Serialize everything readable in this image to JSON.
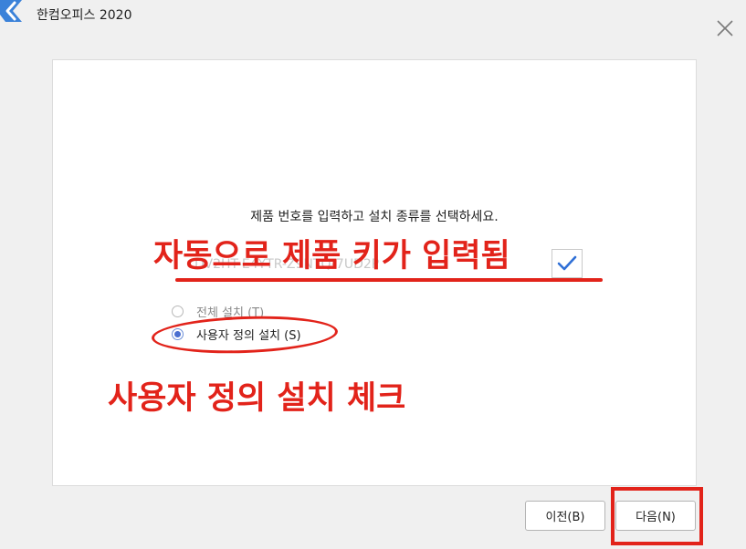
{
  "window": {
    "title": "한컴오피스 2020"
  },
  "main": {
    "instruction": "제품 번호를 입력하고 설치 종류를 선택하세요.",
    "product_key": "DV2HT-E4YTR-Z9NTQ-7UD2P",
    "install_options": [
      {
        "label": "전체 설치 (T)",
        "selected": false
      },
      {
        "label": "사용자 정의 설치 (S)",
        "selected": true
      }
    ]
  },
  "footer": {
    "prev_label": "이전(B)",
    "next_label": "다음(N)"
  },
  "annotations": {
    "key_note": "자동으로 제품 키가 입력됨",
    "custom_note": "사용자 정의 설치 체크"
  },
  "colors": {
    "accent": "#2f6fd6",
    "annotation": "#e2231a",
    "logo": "#2d7fd6"
  },
  "icons": {
    "logo": "hancom-office-logo-icon",
    "close": "close-icon",
    "verify": "checkmark-icon"
  }
}
